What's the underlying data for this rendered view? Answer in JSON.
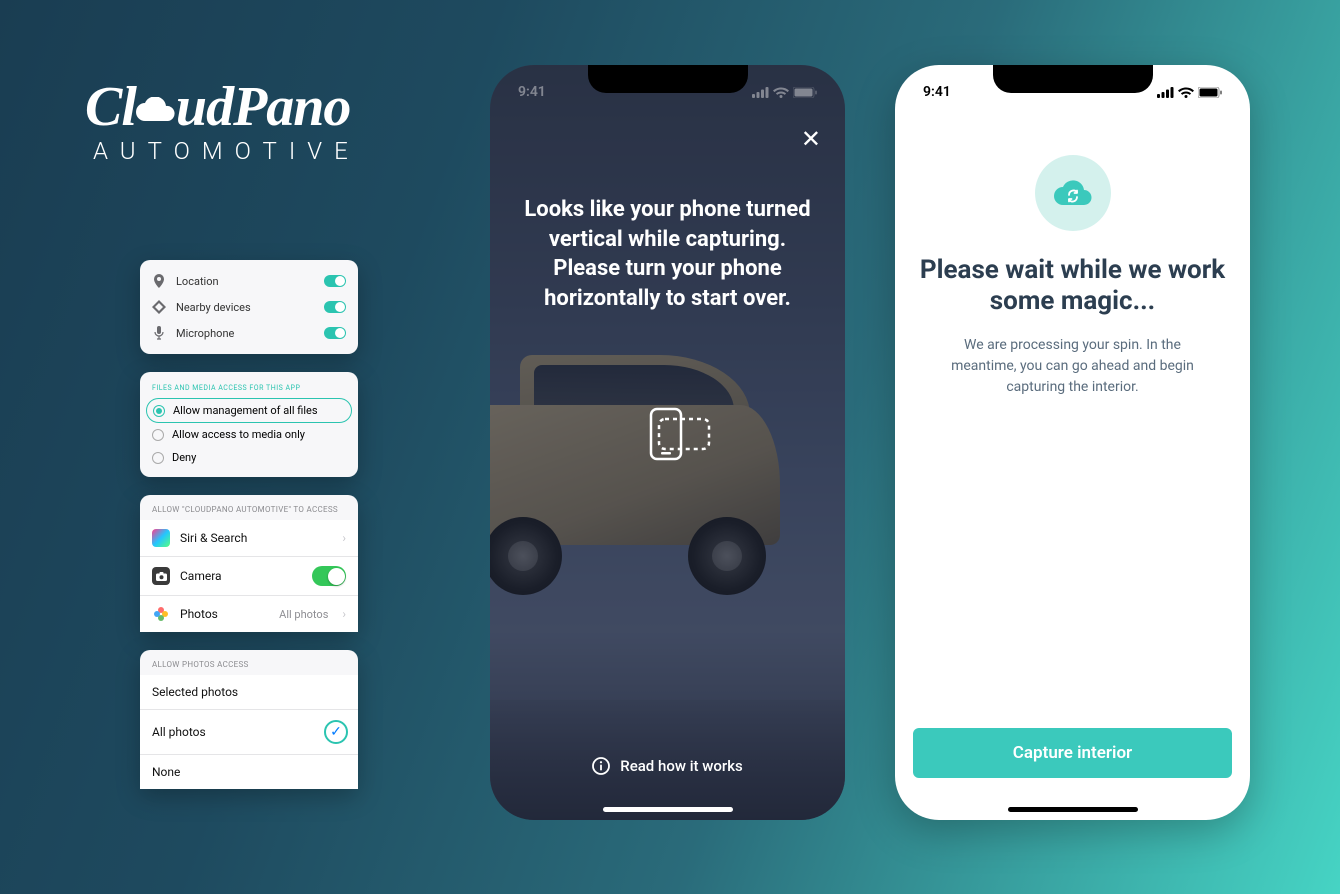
{
  "logo": {
    "main": "CloudPano",
    "sub": "AUTOMOTIVE"
  },
  "status": {
    "time": "9:41"
  },
  "permCard": {
    "items": [
      {
        "icon": "location-icon",
        "label": "Location"
      },
      {
        "icon": "nearby-icon",
        "label": "Nearby devices"
      },
      {
        "icon": "microphone-icon",
        "label": "Microphone"
      }
    ]
  },
  "fileCard": {
    "header": "FILES AND MEDIA ACCESS FOR THIS APP",
    "options": [
      {
        "label": "Allow management of all files",
        "selected": true
      },
      {
        "label": "Allow access to media only",
        "selected": false
      },
      {
        "label": "Deny",
        "selected": false
      }
    ]
  },
  "accessCard": {
    "header": "ALLOW \"CLOUDPANO AUTOMOTIVE\" TO ACCESS",
    "siri": "Siri & Search",
    "camera": "Camera",
    "photos": "Photos",
    "photos_value": "All photos"
  },
  "photosCard": {
    "header": "ALLOW PHOTOS ACCESS",
    "options": [
      "Selected photos",
      "All photos",
      "None"
    ],
    "selected": "All photos"
  },
  "darkPhone": {
    "message": "Looks like your phone turned vertical while capturing. Please turn your phone horizontally to start over.",
    "how_link": "Read how it works"
  },
  "lightPhone": {
    "title": "Please wait while we work some magic...",
    "body": "We are processing your spin. In the meantime, you can go ahead and begin capturing the interior.",
    "button": "Capture interior"
  },
  "colors": {
    "accent": "#3bc9bc",
    "toggle_green": "#34c759"
  }
}
